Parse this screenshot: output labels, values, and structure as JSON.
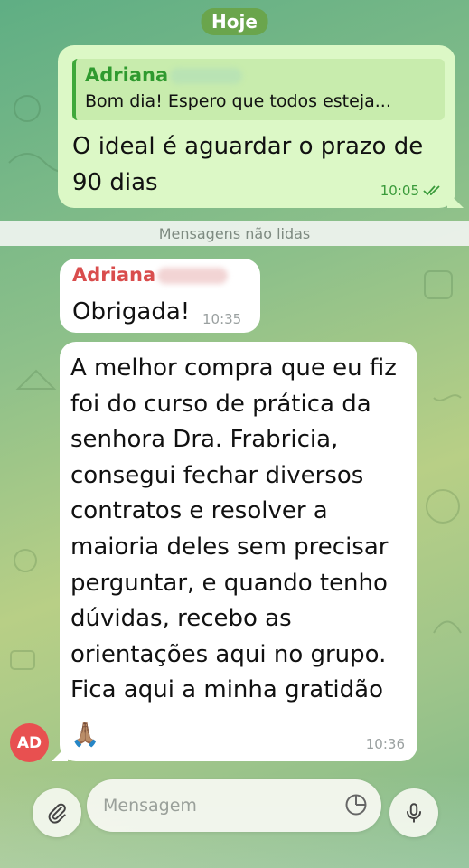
{
  "date_label": "Hoje",
  "outgoing": {
    "reply_name": "Adriana",
    "reply_text": "Bom dia! Espero que todos esteja...",
    "text": "O ideal é aguardar o prazo de 90 dias",
    "time": "10:05"
  },
  "unread_label": "Mensagens não lidas",
  "incoming": [
    {
      "sender": "Adriana",
      "text": "Obrigada!",
      "time": "10:35"
    },
    {
      "text": "A melhor compra que eu fiz foi do curso de prática da senhora Dra. Frabricia, consegui fechar diversos contratos e resolver a maioria deles sem precisar perguntar, e quando tenho dúvidas, recebo as orientações aqui no grupo. Fica aqui a minha gratidão",
      "emoji": "🙏🏽",
      "time": "10:36"
    }
  ],
  "avatar_initials": "AD",
  "input": {
    "placeholder": "Mensagem"
  },
  "icons": {
    "attach": "paperclip-icon",
    "sticker": "sticker-icon",
    "mic": "microphone-icon",
    "read": "double-check-icon"
  },
  "colors": {
    "outgoing_bubble": "#dcf8c6",
    "incoming_bubble": "#ffffff",
    "sender_name": "#d94d4d",
    "reply_name": "#2f9a2f",
    "avatar": "#e85050",
    "date_pill": "#6aa54c"
  }
}
